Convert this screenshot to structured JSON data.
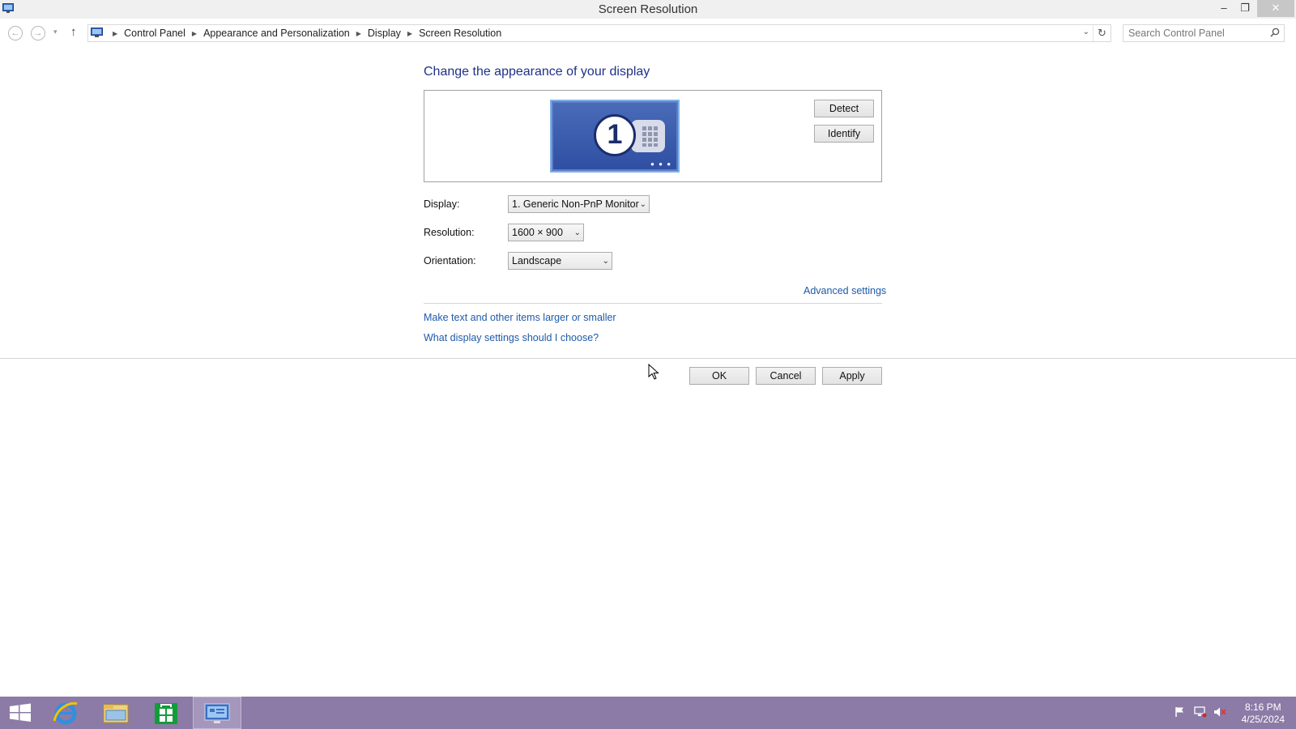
{
  "window": {
    "title": "Screen Resolution",
    "minimize_icon": "–",
    "maximize_icon": "❐",
    "close_icon": "✕"
  },
  "nav": {
    "back_icon": "←",
    "forward_icon": "→",
    "recent_icon": "▾",
    "up_icon": "↑",
    "breadcrumbs": [
      "Control Panel",
      "Appearance and Personalization",
      "Display",
      "Screen Resolution"
    ],
    "breadcrumb_separator": "▶",
    "history_icon": "⌄",
    "refresh_icon": "↻",
    "search_placeholder": "Search Control Panel"
  },
  "content": {
    "heading": "Change the appearance of your display",
    "monitor_number": "1",
    "monitor_dots": "• • •",
    "detect_label": "Detect",
    "identify_label": "Identify",
    "display_label": "Display:",
    "display_value": "1. Generic Non-PnP Monitor",
    "resolution_label": "Resolution:",
    "resolution_value": "1600 × 900",
    "orientation_label": "Orientation:",
    "orientation_value": "Landscape",
    "caret": "⌄",
    "advanced_link": "Advanced settings",
    "text_size_link": "Make text and other items larger or smaller",
    "help_link": "What display settings should I choose?",
    "ok_label": "OK",
    "cancel_label": "Cancel",
    "apply_label": "Apply"
  },
  "taskbar": {
    "items": [
      "start-icon",
      "internet-explorer-icon",
      "file-explorer-icon",
      "store-icon",
      "control-panel-icon"
    ],
    "tray_icons": [
      "flag-icon",
      "network-icon",
      "volume-muted-icon"
    ],
    "time": "8:16 PM",
    "date": "4/25/2024"
  },
  "colors": {
    "taskbar": "#8c7ba6",
    "link": "#1e5aa8",
    "heading": "#1e3287",
    "monitor": "#3a5bb0"
  }
}
